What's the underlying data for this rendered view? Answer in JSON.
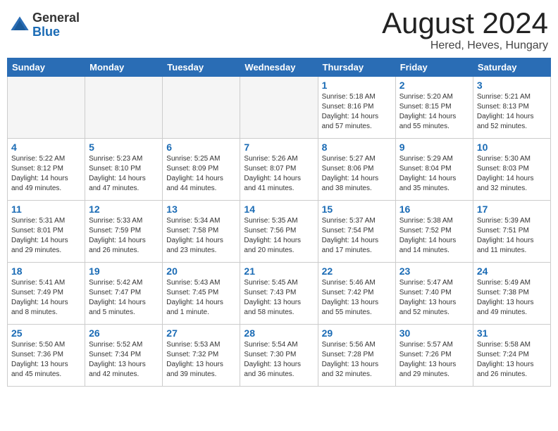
{
  "header": {
    "logo_general": "General",
    "logo_blue": "Blue",
    "month_title": "August 2024",
    "location": "Hered, Heves, Hungary"
  },
  "weekdays": [
    "Sunday",
    "Monday",
    "Tuesday",
    "Wednesday",
    "Thursday",
    "Friday",
    "Saturday"
  ],
  "weeks": [
    [
      {
        "day": "",
        "info": ""
      },
      {
        "day": "",
        "info": ""
      },
      {
        "day": "",
        "info": ""
      },
      {
        "day": "",
        "info": ""
      },
      {
        "day": "1",
        "info": "Sunrise: 5:18 AM\nSunset: 8:16 PM\nDaylight: 14 hours\nand 57 minutes."
      },
      {
        "day": "2",
        "info": "Sunrise: 5:20 AM\nSunset: 8:15 PM\nDaylight: 14 hours\nand 55 minutes."
      },
      {
        "day": "3",
        "info": "Sunrise: 5:21 AM\nSunset: 8:13 PM\nDaylight: 14 hours\nand 52 minutes."
      }
    ],
    [
      {
        "day": "4",
        "info": "Sunrise: 5:22 AM\nSunset: 8:12 PM\nDaylight: 14 hours\nand 49 minutes."
      },
      {
        "day": "5",
        "info": "Sunrise: 5:23 AM\nSunset: 8:10 PM\nDaylight: 14 hours\nand 47 minutes."
      },
      {
        "day": "6",
        "info": "Sunrise: 5:25 AM\nSunset: 8:09 PM\nDaylight: 14 hours\nand 44 minutes."
      },
      {
        "day": "7",
        "info": "Sunrise: 5:26 AM\nSunset: 8:07 PM\nDaylight: 14 hours\nand 41 minutes."
      },
      {
        "day": "8",
        "info": "Sunrise: 5:27 AM\nSunset: 8:06 PM\nDaylight: 14 hours\nand 38 minutes."
      },
      {
        "day": "9",
        "info": "Sunrise: 5:29 AM\nSunset: 8:04 PM\nDaylight: 14 hours\nand 35 minutes."
      },
      {
        "day": "10",
        "info": "Sunrise: 5:30 AM\nSunset: 8:03 PM\nDaylight: 14 hours\nand 32 minutes."
      }
    ],
    [
      {
        "day": "11",
        "info": "Sunrise: 5:31 AM\nSunset: 8:01 PM\nDaylight: 14 hours\nand 29 minutes."
      },
      {
        "day": "12",
        "info": "Sunrise: 5:33 AM\nSunset: 7:59 PM\nDaylight: 14 hours\nand 26 minutes."
      },
      {
        "day": "13",
        "info": "Sunrise: 5:34 AM\nSunset: 7:58 PM\nDaylight: 14 hours\nand 23 minutes."
      },
      {
        "day": "14",
        "info": "Sunrise: 5:35 AM\nSunset: 7:56 PM\nDaylight: 14 hours\nand 20 minutes."
      },
      {
        "day": "15",
        "info": "Sunrise: 5:37 AM\nSunset: 7:54 PM\nDaylight: 14 hours\nand 17 minutes."
      },
      {
        "day": "16",
        "info": "Sunrise: 5:38 AM\nSunset: 7:52 PM\nDaylight: 14 hours\nand 14 minutes."
      },
      {
        "day": "17",
        "info": "Sunrise: 5:39 AM\nSunset: 7:51 PM\nDaylight: 14 hours\nand 11 minutes."
      }
    ],
    [
      {
        "day": "18",
        "info": "Sunrise: 5:41 AM\nSunset: 7:49 PM\nDaylight: 14 hours\nand 8 minutes."
      },
      {
        "day": "19",
        "info": "Sunrise: 5:42 AM\nSunset: 7:47 PM\nDaylight: 14 hours\nand 5 minutes."
      },
      {
        "day": "20",
        "info": "Sunrise: 5:43 AM\nSunset: 7:45 PM\nDaylight: 14 hours\nand 1 minute."
      },
      {
        "day": "21",
        "info": "Sunrise: 5:45 AM\nSunset: 7:43 PM\nDaylight: 13 hours\nand 58 minutes."
      },
      {
        "day": "22",
        "info": "Sunrise: 5:46 AM\nSunset: 7:42 PM\nDaylight: 13 hours\nand 55 minutes."
      },
      {
        "day": "23",
        "info": "Sunrise: 5:47 AM\nSunset: 7:40 PM\nDaylight: 13 hours\nand 52 minutes."
      },
      {
        "day": "24",
        "info": "Sunrise: 5:49 AM\nSunset: 7:38 PM\nDaylight: 13 hours\nand 49 minutes."
      }
    ],
    [
      {
        "day": "25",
        "info": "Sunrise: 5:50 AM\nSunset: 7:36 PM\nDaylight: 13 hours\nand 45 minutes."
      },
      {
        "day": "26",
        "info": "Sunrise: 5:52 AM\nSunset: 7:34 PM\nDaylight: 13 hours\nand 42 minutes."
      },
      {
        "day": "27",
        "info": "Sunrise: 5:53 AM\nSunset: 7:32 PM\nDaylight: 13 hours\nand 39 minutes."
      },
      {
        "day": "28",
        "info": "Sunrise: 5:54 AM\nSunset: 7:30 PM\nDaylight: 13 hours\nand 36 minutes."
      },
      {
        "day": "29",
        "info": "Sunrise: 5:56 AM\nSunset: 7:28 PM\nDaylight: 13 hours\nand 32 minutes."
      },
      {
        "day": "30",
        "info": "Sunrise: 5:57 AM\nSunset: 7:26 PM\nDaylight: 13 hours\nand 29 minutes."
      },
      {
        "day": "31",
        "info": "Sunrise: 5:58 AM\nSunset: 7:24 PM\nDaylight: 13 hours\nand 26 minutes."
      }
    ]
  ]
}
